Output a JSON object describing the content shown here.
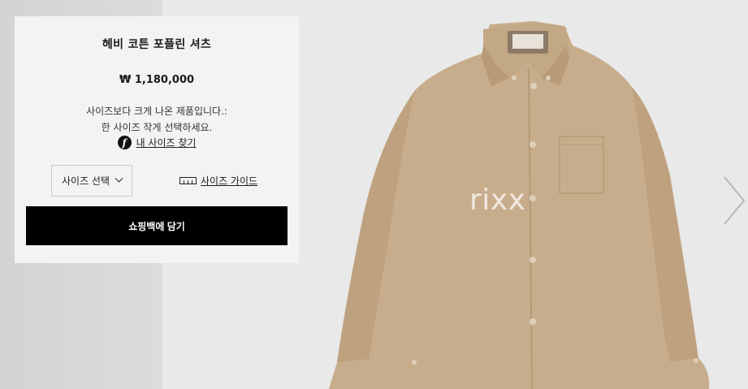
{
  "product": {
    "title": "헤비 코튼 포플린 셔츠",
    "price": "₩ 1,180,000",
    "fit_note_line1": "사이즈보다 크게 나온 제품입니다.:",
    "fit_note_line2": "한 사이즈 작게 선택하세요.",
    "fit_finder_label": "내 사이즈 찾기",
    "fit_finder_icon": "f-logo-icon",
    "size_select_label": "사이즈 선택",
    "size_guide_label": "사이즈 가이드",
    "size_guide_icon": "ruler-icon",
    "add_to_bag_label": "쇼핑백에 담기"
  },
  "image": {
    "watermark": "rixx",
    "description_icon": "shirt-image",
    "shirt_color": "#c8ad8c"
  },
  "carousel": {
    "next_icon": "chevron-right-icon"
  },
  "colors": {
    "button_bg": "#000000",
    "panel_bg": "#f3f3f3",
    "page_bg": "#e9e9e9"
  }
}
